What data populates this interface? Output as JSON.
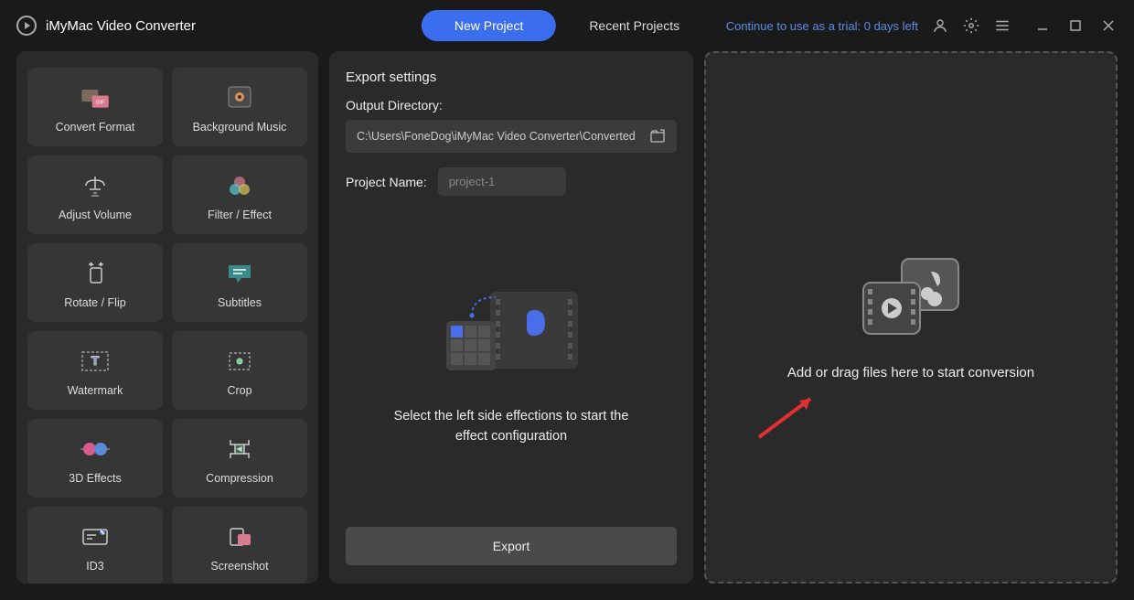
{
  "app": {
    "title": "iMyMac Video Converter"
  },
  "tabs": {
    "new": "New Project",
    "recent": "Recent Projects"
  },
  "trial": "Continue to use as a trial: 0 days left",
  "tools": [
    {
      "label": "Convert Format"
    },
    {
      "label": "Background Music"
    },
    {
      "label": "Adjust Volume"
    },
    {
      "label": "Filter / Effect"
    },
    {
      "label": "Rotate / Flip"
    },
    {
      "label": "Subtitles"
    },
    {
      "label": "Watermark"
    },
    {
      "label": "Crop"
    },
    {
      "label": "3D Effects"
    },
    {
      "label": "Compression"
    },
    {
      "label": "ID3"
    },
    {
      "label": "Screenshot"
    }
  ],
  "export": {
    "title": "Export settings",
    "dirLabel": "Output Directory:",
    "dirValue": "C:\\Users\\FoneDog\\iMyMac Video Converter\\Converted",
    "nameLabel": "Project Name:",
    "nameValue": "project-1",
    "hint": "Select the left side effections to start the effect configuration",
    "button": "Export"
  },
  "drop": {
    "text": "Add or drag files here to start conversion"
  }
}
